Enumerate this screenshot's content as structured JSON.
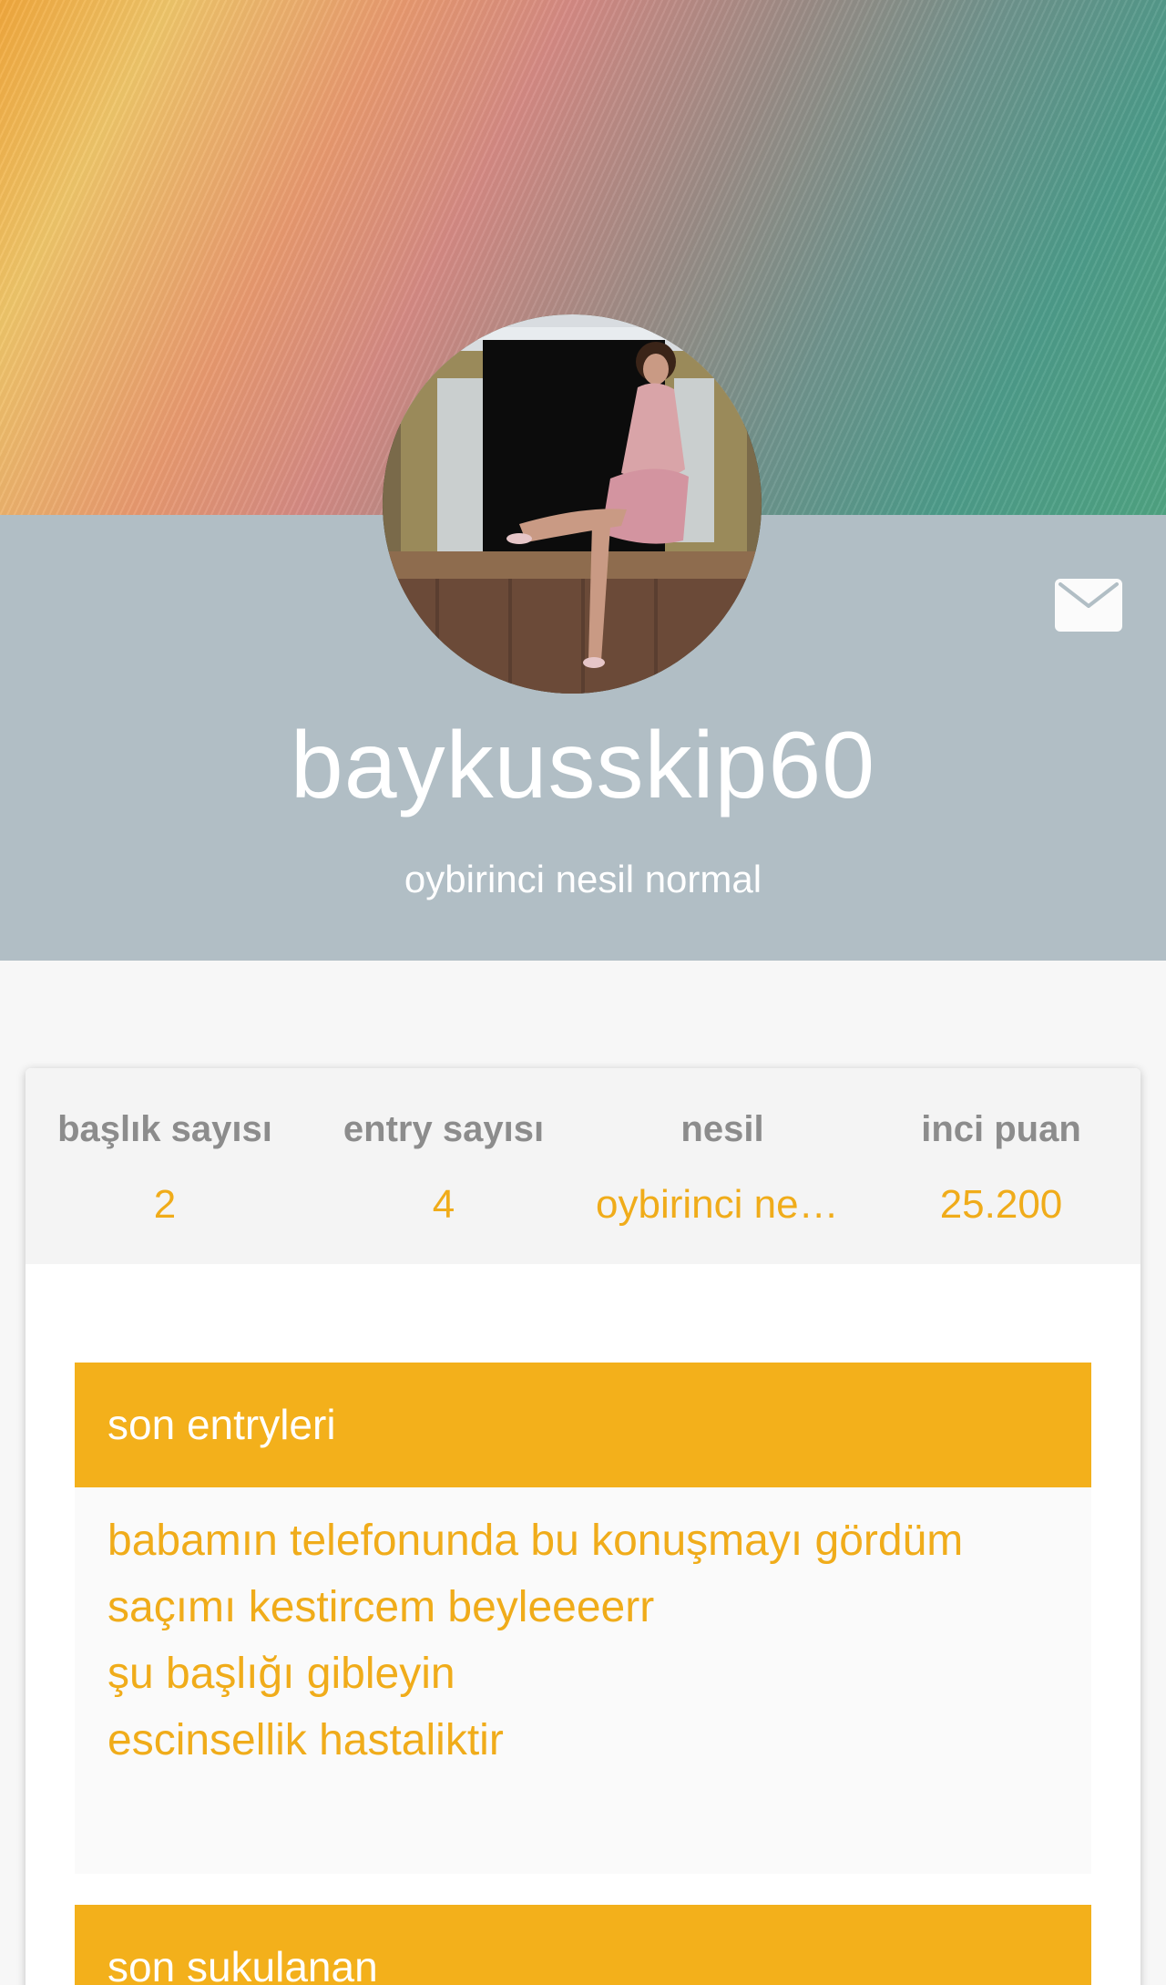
{
  "profile": {
    "username": "baykusskip60",
    "generation": "oybirinci nesil normal",
    "message_icon": "envelope-icon"
  },
  "stats": [
    {
      "label": "başlık sayısı",
      "value": "2"
    },
    {
      "label": "entry sayısı",
      "value": "4"
    },
    {
      "label": "nesil",
      "value": "oybirinci nesi…"
    },
    {
      "label": "inci puan",
      "value": "25.200"
    }
  ],
  "sections": {
    "recent_entries": {
      "title": "son entryleri",
      "items": [
        "babamın telefonunda bu konuşmayı gördüm",
        "saçımı kestircem beyleeeerr",
        "şu başlığı gibleyin",
        "escinsellik hastaliktir"
      ]
    },
    "recent_likes": {
      "title": "son sukulanan"
    }
  },
  "colors": {
    "accent": "#f3b01b",
    "link": "#f0ac1a",
    "header_band": "#b1bec5",
    "stat_label": "#8c8c8c"
  }
}
